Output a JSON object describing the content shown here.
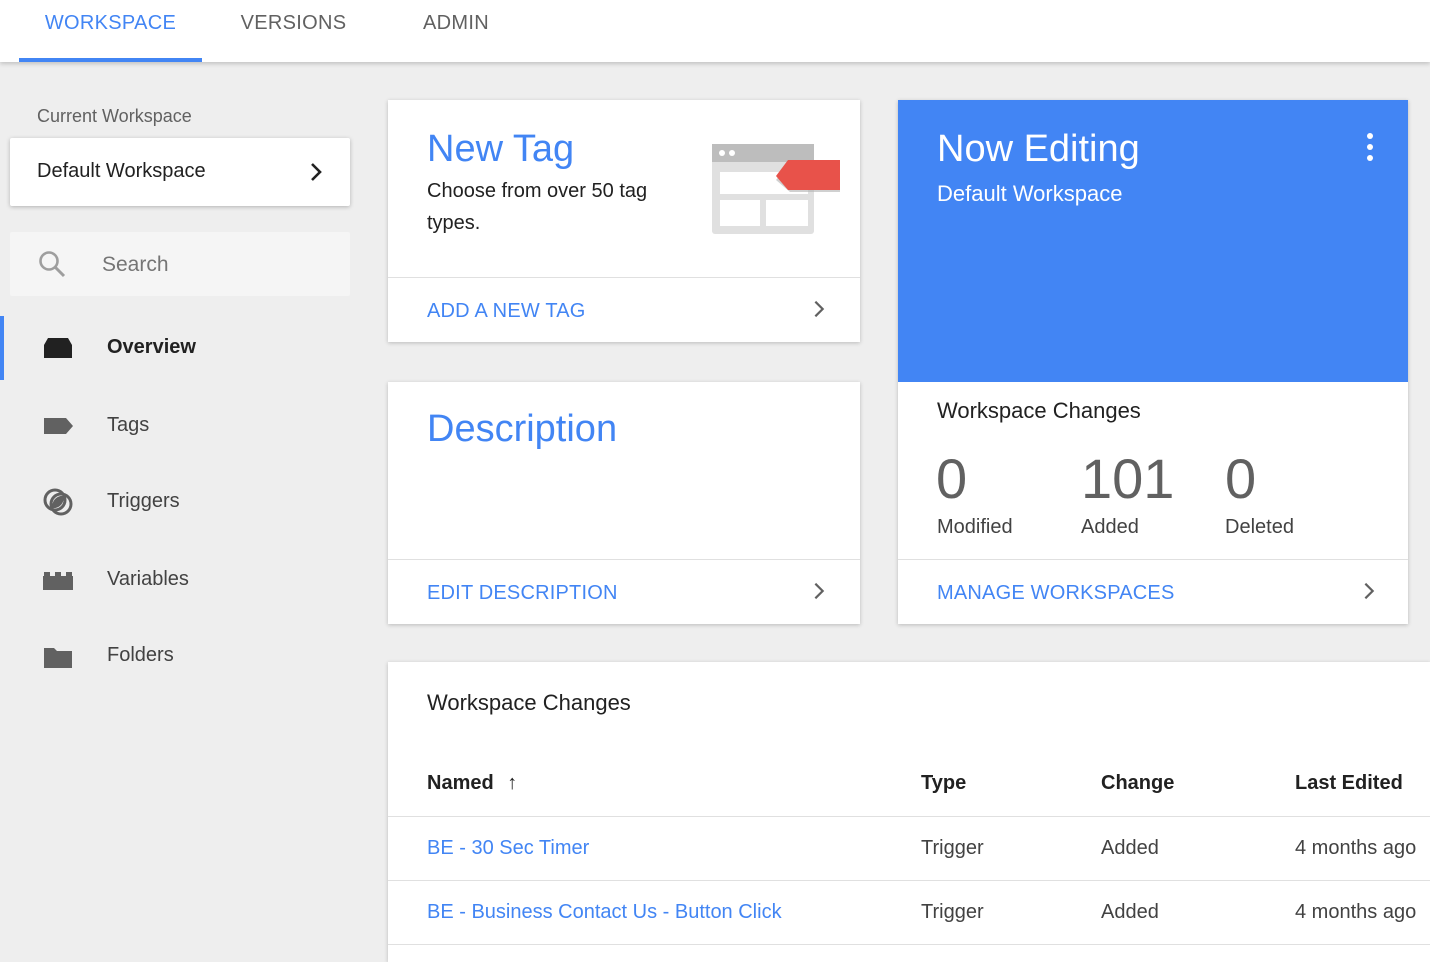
{
  "top_tabs": [
    {
      "label": "WORKSPACE",
      "active": true
    },
    {
      "label": "VERSIONS",
      "active": false
    },
    {
      "label": "ADMIN",
      "active": false
    }
  ],
  "sidebar": {
    "current_workspace_label": "Current Workspace",
    "workspace_name": "Default Workspace",
    "search_placeholder": "Search",
    "items": [
      {
        "label": "Overview",
        "icon": "overview-icon",
        "active": true
      },
      {
        "label": "Tags",
        "icon": "tag-icon",
        "active": false
      },
      {
        "label": "Triggers",
        "icon": "trigger-icon",
        "active": false
      },
      {
        "label": "Variables",
        "icon": "variables-icon",
        "active": false
      },
      {
        "label": "Folders",
        "icon": "folder-icon",
        "active": false
      }
    ]
  },
  "new_tag_card": {
    "title": "New Tag",
    "desc_line1": "Choose from over 50 tag",
    "desc_line2": "types.",
    "action": "ADD A NEW TAG"
  },
  "description_card": {
    "title": "Description",
    "action": "EDIT DESCRIPTION"
  },
  "now_editing_card": {
    "title": "Now Editing",
    "subtitle": "Default Workspace",
    "changes_heading": "Workspace Changes",
    "stats": [
      {
        "value": "0",
        "label": "Modified"
      },
      {
        "value": "101",
        "label": "Added"
      },
      {
        "value": "0",
        "label": "Deleted"
      }
    ],
    "action": "MANAGE WORKSPACES"
  },
  "changes_table": {
    "heading": "Workspace Changes",
    "columns": {
      "named": "Named",
      "type": "Type",
      "change": "Change",
      "last_edited": "Last Edited"
    },
    "sort_indicator": "↑",
    "rows": [
      {
        "name": "BE - 30 Sec Timer",
        "type": "Trigger",
        "change": "Added",
        "last_edited": "4 months ago"
      },
      {
        "name": "BE - Business Contact Us - Button Click",
        "type": "Trigger",
        "change": "Added",
        "last_edited": "4 months ago"
      }
    ]
  },
  "colors": {
    "accent": "#4285f4",
    "tag_red": "#e8524a",
    "background": "#eeeeee"
  }
}
